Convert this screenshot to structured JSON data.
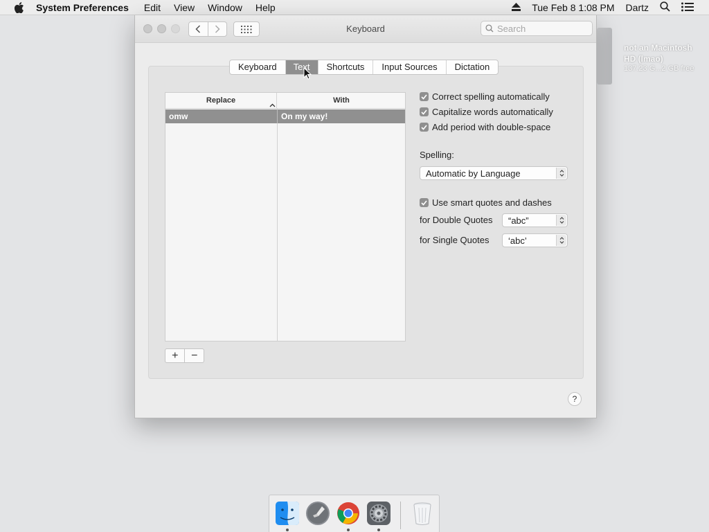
{
  "menubar": {
    "app_name": "System Preferences",
    "menus": [
      "Edit",
      "View",
      "Window",
      "Help"
    ],
    "datetime": "Tue Feb 8  1:08 PM",
    "user": "Dartz"
  },
  "desktop": {
    "drive_name_line1": "not an Macintosh",
    "drive_name_line2": "HD (lmao)",
    "drive_free": "137.23 G...2 GB free"
  },
  "window": {
    "title": "Keyboard",
    "search_placeholder": "Search"
  },
  "tabs": [
    {
      "label": "Keyboard",
      "active": false
    },
    {
      "label": "Text",
      "active": true
    },
    {
      "label": "Shortcuts",
      "active": false
    },
    {
      "label": "Input Sources",
      "active": false
    },
    {
      "label": "Dictation",
      "active": false
    }
  ],
  "table": {
    "headers": {
      "replace": "Replace",
      "with": "With"
    },
    "rows": [
      {
        "replace": "omw",
        "with": "On my way!",
        "selected": true
      }
    ]
  },
  "options": {
    "correct_spelling": {
      "label": "Correct spelling automatically",
      "checked": true
    },
    "capitalize": {
      "label": "Capitalize words automatically",
      "checked": true
    },
    "add_period": {
      "label": "Add period with double-space",
      "checked": true
    },
    "spelling_label": "Spelling:",
    "spelling_value": "Automatic by Language",
    "smart_quotes": {
      "label": "Use smart quotes and dashes",
      "checked": true
    },
    "double_quotes_label": "for Double Quotes",
    "double_quotes_value": "“abc”",
    "single_quotes_label": "for Single Quotes",
    "single_quotes_value": "‘abc’"
  },
  "buttons": {
    "add": "+",
    "remove": "−",
    "help": "?"
  },
  "dock": {
    "items": [
      {
        "name": "Finder",
        "running": true
      },
      {
        "name": "Launchpad",
        "running": false
      },
      {
        "name": "Google Chrome",
        "running": true
      },
      {
        "name": "System Preferences",
        "running": true
      },
      {
        "name": "Trash",
        "running": false
      }
    ]
  },
  "colors": {
    "selection_gray": "#909090",
    "desktop_bg": "#e3e4e6"
  }
}
